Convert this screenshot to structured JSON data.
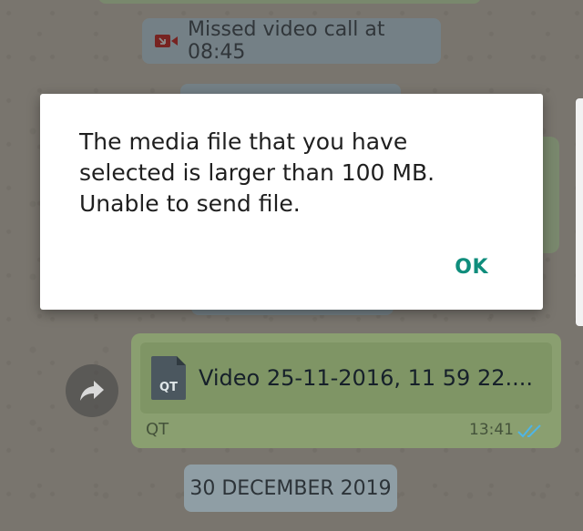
{
  "chat": {
    "missed_call_text": "Missed video call at 08:45",
    "file_message": {
      "file_name": "Video 25-11-2016, 11 59 22....",
      "file_type": "QT",
      "icon_label": "QT",
      "time": "13:41"
    },
    "date_separator": "30 DECEMBER 2019"
  },
  "dialog": {
    "message": "The media file that you have selected is larger than 100 MB. Unable to send file.",
    "ok_label": "OK"
  },
  "colors": {
    "accent": "#0f8d7c",
    "missed_call_icon": "#d9413c",
    "read_ticks": "#4fb5e6"
  }
}
